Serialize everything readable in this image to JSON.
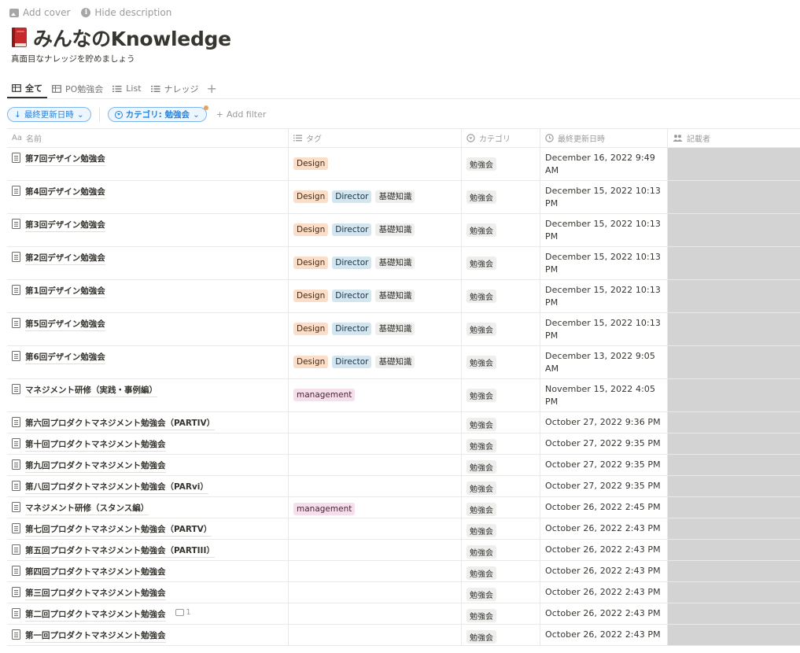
{
  "top_actions": {
    "add_cover": "Add cover",
    "hide_description": "Hide description"
  },
  "page": {
    "title": "みんなのKnowledge",
    "description": "真面目なナレッジを貯めましょう",
    "icon": "red-book-icon"
  },
  "tabs": [
    {
      "label": "全て",
      "icon": "table-icon",
      "active": true
    },
    {
      "label": "PO勉強会",
      "icon": "table-icon",
      "active": false
    },
    {
      "label": "List",
      "icon": "list-icon",
      "active": false
    },
    {
      "label": "ナレッジ",
      "icon": "list-icon",
      "active": false
    }
  ],
  "filters": {
    "sort_label": "最終更新日時",
    "category_label": "カテゴリ: 勉強会",
    "add_filter": "Add filter"
  },
  "columns": {
    "name": "名前",
    "name_icon": "Aa",
    "tags": "タグ",
    "category": "カテゴリ",
    "updated": "最終更新日時",
    "author": "記載者"
  },
  "rows": [
    {
      "name": "第7回デザイン勉強会",
      "tags": [
        "Design"
      ],
      "category": "勉強会",
      "updated": "December 16, 2022 9:49 AM"
    },
    {
      "name": "第4回デザイン勉強会",
      "tags": [
        "Design",
        "Director",
        "基礎知識"
      ],
      "category": "勉強会",
      "updated": "December 15, 2022 10:13 PM"
    },
    {
      "name": "第3回デザイン勉強会",
      "tags": [
        "Design",
        "Director",
        "基礎知識"
      ],
      "category": "勉強会",
      "updated": "December 15, 2022 10:13 PM"
    },
    {
      "name": "第2回デザイン勉強会",
      "tags": [
        "Design",
        "Director",
        "基礎知識"
      ],
      "category": "勉強会",
      "updated": "December 15, 2022 10:13 PM"
    },
    {
      "name": "第1回デザイン勉強会",
      "tags": [
        "Design",
        "Director",
        "基礎知識"
      ],
      "category": "勉強会",
      "updated": "December 15, 2022 10:13 PM"
    },
    {
      "name": "第5回デザイン勉強会",
      "tags": [
        "Design",
        "Director",
        "基礎知識"
      ],
      "category": "勉強会",
      "updated": "December 15, 2022 10:13 PM"
    },
    {
      "name": "第6回デザイン勉強会",
      "tags": [
        "Design",
        "Director",
        "基礎知識"
      ],
      "category": "勉強会",
      "updated": "December 13, 2022 9:05 AM"
    },
    {
      "name": "マネジメント研修（実践・事例編）",
      "tags": [
        "management"
      ],
      "category": "勉強会",
      "updated": "November 15, 2022 4:05 PM"
    },
    {
      "name": "第六回プロダクトマネジメント勉強会（PARTIV）",
      "tags": [],
      "category": "勉強会",
      "updated": "October 27, 2022 9:36 PM"
    },
    {
      "name": "第十回プロダクトマネジメント勉強会",
      "tags": [],
      "category": "勉強会",
      "updated": "October 27, 2022 9:35 PM"
    },
    {
      "name": "第九回プロダクトマネジメント勉強会",
      "tags": [],
      "category": "勉強会",
      "updated": "October 27, 2022 9:35 PM"
    },
    {
      "name": "第八回プロダクトマネジメント勉強会（PARvi）",
      "tags": [],
      "category": "勉強会",
      "updated": "October 27, 2022 9:35 PM"
    },
    {
      "name": "マネジメント研修（スタンス編）",
      "tags": [
        "management"
      ],
      "category": "勉強会",
      "updated": "October 26, 2022 2:45 PM"
    },
    {
      "name": "第七回プロダクトマネジメント勉強会（PARTV）",
      "tags": [],
      "category": "勉強会",
      "updated": "October 26, 2022 2:43 PM"
    },
    {
      "name": "第五回プロダクトマネジメント勉強会（PARTIII）",
      "tags": [],
      "category": "勉強会",
      "updated": "October 26, 2022 2:43 PM"
    },
    {
      "name": "第四回プロダクトマネジメント勉強会",
      "tags": [],
      "category": "勉強会",
      "updated": "October 26, 2022 2:43 PM"
    },
    {
      "name": "第三回プロダクトマネジメント勉強会",
      "tags": [],
      "category": "勉強会",
      "updated": "October 26, 2022 2:43 PM"
    },
    {
      "name": "第二回プロダクトマネジメント勉強会",
      "tags": [],
      "category": "勉強会",
      "updated": "October 26, 2022 2:43 PM",
      "comment_count": "1"
    },
    {
      "name": "第一回プロダクトマネジメント勉強会",
      "tags": [],
      "category": "勉強会",
      "updated": "October 26, 2022 2:43 PM"
    }
  ],
  "colors": {
    "accent": "#2383e2",
    "design_tag": "#fadec9",
    "director_tag": "#d3e5ef",
    "kiso_tag": "#eeeeed",
    "management_tag": "#f4dfeb",
    "author_redacted": "#d3d3d3"
  }
}
